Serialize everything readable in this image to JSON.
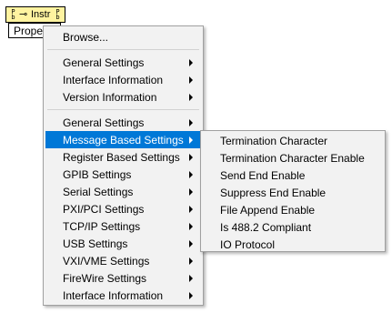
{
  "node": {
    "ref_left": [
      "P",
      "b"
    ],
    "ref_right": [
      "P",
      "b"
    ],
    "arrow": "⊸",
    "name": "Instr",
    "property": "Prope"
  },
  "menu": {
    "top": "Browse...",
    "group1": [
      "General Settings",
      "Interface Information",
      "Version Information"
    ],
    "group2": [
      "General Settings",
      "Message Based Settings",
      "Register Based Settings",
      "GPIB Settings",
      "Serial Settings",
      "PXI/PCI Settings",
      "TCP/IP Settings",
      "USB Settings",
      "VXI/VME Settings",
      "FireWire Settings",
      "Interface Information"
    ],
    "active_item": "Message Based Settings"
  },
  "submenu": {
    "items": [
      "Termination Character",
      "Termination Character Enable",
      "Send End Enable",
      "Suppress End Enable",
      "File Append Enable",
      "Is 488.2 Compliant",
      "IO Protocol"
    ]
  },
  "colors": {
    "highlight": "#0078d7",
    "menu_bg": "#f2f2f2",
    "node_bg": "#fff3a0"
  }
}
